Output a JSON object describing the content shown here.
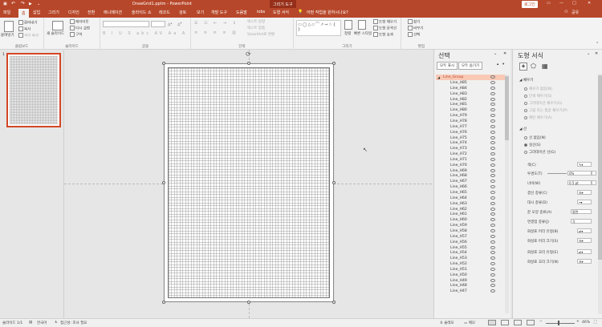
{
  "title_bar": {
    "doc_title": "DrawGrid1.pptm - PowerPoint",
    "context_tool": "그리기 도구",
    "login": "로그인"
  },
  "tabs": [
    {
      "label": "파일"
    },
    {
      "label": "홈"
    },
    {
      "label": "삽입"
    },
    {
      "label": "그리기"
    },
    {
      "label": "디자인"
    },
    {
      "label": "전환"
    },
    {
      "label": "애니메이션"
    },
    {
      "label": "슬라이드 쇼"
    },
    {
      "label": "레코드"
    },
    {
      "label": "검토"
    },
    {
      "label": "보기"
    },
    {
      "label": "개발 도구"
    },
    {
      "label": "도움말"
    },
    {
      "label": "iobs"
    },
    {
      "label": "도형 서식"
    }
  ],
  "tell_me": "어떤 작업을 원하시나요?",
  "share": "공유",
  "ribbon": {
    "paste": "붙여넣기",
    "cut": "잘라내기",
    "copy": "복사",
    "format_painter": "서식 복사",
    "clipboard_label": "클립보드",
    "new_slide": "새 슬라이드",
    "layout": "레이아웃",
    "reset": "다시 설정",
    "section": "구역",
    "slides_label": "슬라이드",
    "font_label": "글꼴",
    "paragraph_label": "단락",
    "text_direction": "텍스트 방향",
    "align_text": "텍스트 맞춤",
    "smartart": "SmartArt로 변환",
    "arrange": "정렬",
    "quick_styles": "빠른 스타일",
    "shape_fill": "도형 채우기",
    "shape_outline": "도형 윤곽선",
    "shape_effects": "도형 효과",
    "drawing_label": "그리기",
    "find": "찾기",
    "replace": "바꾸기",
    "select": "선택",
    "editing_label": "편집"
  },
  "thumb_pane": {
    "slide_number": "1"
  },
  "selection_pane": {
    "title": "선택",
    "show_all": "모두 표시",
    "hide_all": "모두 숨기기",
    "group": "Line_Group",
    "items": [
      "Line_H85",
      "Line_H84",
      "Line_H83",
      "Line_H82",
      "Line_H81",
      "Line_H80",
      "Line_H79",
      "Line_H78",
      "Line_H77",
      "Line_H76",
      "Line_H75",
      "Line_H74",
      "Line_H73",
      "Line_H72",
      "Line_H71",
      "Line_H70",
      "Line_H69",
      "Line_H68",
      "Line_H67",
      "Line_H66",
      "Line_H65",
      "Line_H64",
      "Line_H63",
      "Line_H62",
      "Line_H61",
      "Line_H60",
      "Line_H59",
      "Line_H58",
      "Line_H57",
      "Line_H56",
      "Line_H55",
      "Line_H54",
      "Line_H53",
      "Line_H52",
      "Line_H51",
      "Line_H50",
      "Line_H49",
      "Line_H48",
      "Line_H47"
    ]
  },
  "format_pane": {
    "title": "도형 서식",
    "fill_section": "채우기",
    "fill_options": [
      "채우기 없음(N)",
      "단색 채우기(S)",
      "그라데이션 채우기(G)",
      "그림 또는 질감 채우기(P)",
      "패턴 채우기(A)"
    ],
    "line_section": "선",
    "line_options": [
      "선 없음(N)",
      "실선(S)",
      "그라데이션 선(G)"
    ],
    "color": "색(C)",
    "transparency": "투명도(T)",
    "transparency_value": "0%",
    "width": "너비(W)",
    "width_value": "0.5 pt",
    "compound": "겹선 종류(C)",
    "dash": "대시 종류(D)",
    "cap": "끝 모양 종류(A)",
    "cap_value": "평면",
    "join": "연결점 종류(J)",
    "join_value": "각",
    "begin_arrow_type": "화살표 머리 유형(B)",
    "begin_arrow_size": "화살표 머리 크기(S)",
    "end_arrow_type": "화살표 꼬리 유형(E)",
    "end_arrow_size": "화살표 꼬리 크기(N)"
  },
  "status": {
    "slide": "슬라이드 1/1",
    "language": "한국어",
    "accessibility": "접근성: 조사 필요",
    "notes": "슬레모",
    "comments": "메모",
    "zoom": "46%"
  },
  "colors": {
    "accent": "#b7472a",
    "selected": "#f9c9b6"
  }
}
